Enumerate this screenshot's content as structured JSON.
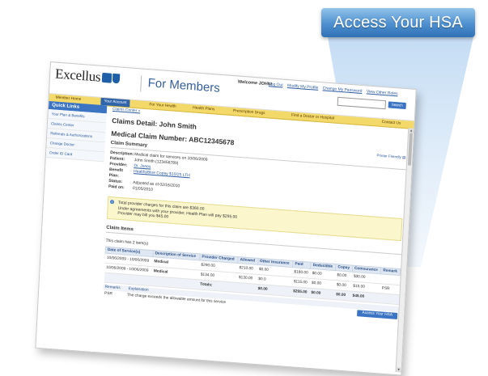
{
  "callout": {
    "label": "Access Your HSA"
  },
  "header": {
    "brand": "Excellus",
    "portal": "For Members",
    "welcome": "Welcome JOHN!",
    "links": [
      "Log Out",
      "Modify My Profile",
      "Change My Password",
      "View Other Roles"
    ],
    "search_button": "Search"
  },
  "nav": {
    "tabs": [
      "Member Home",
      "Your Account",
      "For Your Health",
      "Health Plans",
      "Prescription Drugs",
      "Find a Doctor or Hospital",
      "Contact Us"
    ]
  },
  "sidebar": {
    "title": "Quick Links",
    "items": [
      "Your Plan & Benefits",
      "Claims Center",
      "Referrals & Authorizations",
      "Change Doctor",
      "Order ID Card"
    ]
  },
  "main": {
    "breadcrumb": "Claims Center »",
    "title": "Claims Detail: John Smith",
    "claim_number": "Medical Claim Number: ABC12345678",
    "printer_link": "Printer Friendly",
    "summary_title": "Claim Summary",
    "summary": {
      "description_label": "Description:",
      "description": "Medical claim for services on 10/06/2009",
      "patient_label": "Patient:",
      "patient": "John Smith (123456789)",
      "provider_label": "Provider:",
      "provider": "Dr. Jones",
      "plan_label": "Benefit Plan:",
      "plan": "HealthyBlue Copay $10/25 LTH",
      "status_label": "Status:",
      "status": "Adjusted as of 02/16/2010",
      "paid_label": "Paid on:",
      "paid": "01/05/2010"
    },
    "notice": {
      "line1": "Total provider charges for this claim are $360.00",
      "line2": "Under agreements with your provider, Health Plan will pay $295.00",
      "line3": "Provider may bill you $45.00"
    },
    "items_title": "Claim Items",
    "items_count": "This claim has 2 item(s)",
    "hsa_button": "Access Your HSA",
    "table": {
      "headers": [
        "Date of Service(s)",
        "Description of Service",
        "Provider Charged",
        "Allowed",
        "Other Insurance",
        "Paid",
        "Deductible",
        "Copay",
        "Coinsurance",
        "Remark"
      ],
      "rows": [
        [
          "10/06/2009 - 10/06/2009",
          "Medical",
          "$290.00",
          "$210.00",
          "$0.00",
          "$180.00",
          "$0.00",
          "$0.00",
          "$30.00",
          ""
        ],
        [
          "10/06/2009 - 10/06/2009",
          "Medical",
          "$134.00",
          "$130.00",
          "$0.0",
          "$115.00",
          "$0.00",
          "$0.00",
          "$15.00",
          "PSR"
        ]
      ],
      "total_label": "Totals:",
      "totals": [
        "$0.00",
        "$295.00",
        "$0.00",
        "$0.00",
        "$45.00"
      ]
    },
    "remarks": {
      "headers": [
        "Remarks",
        "Explanation"
      ],
      "code": "PSR",
      "explanation": "The charge exceeds the allowable amount for this service"
    }
  }
}
